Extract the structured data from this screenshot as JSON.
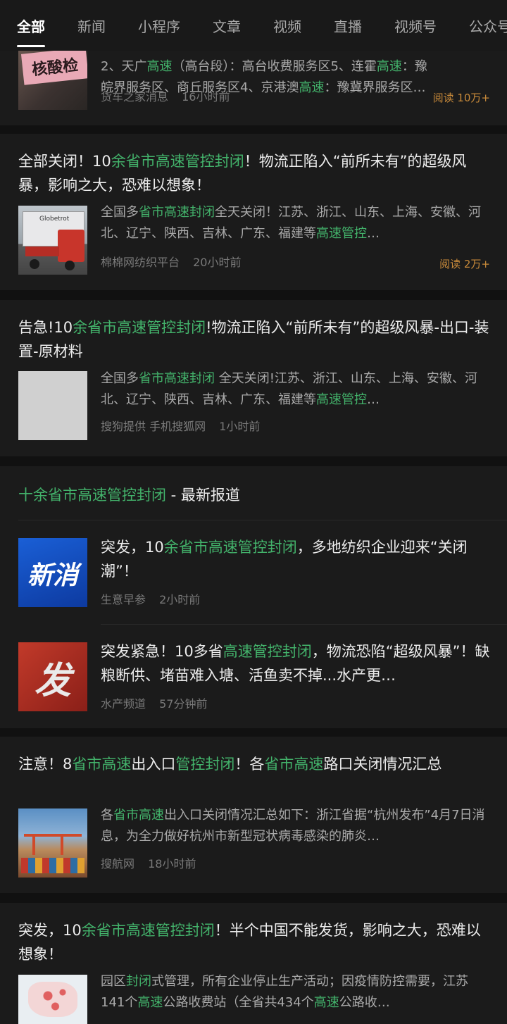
{
  "tabs": [
    "全部",
    "新闻",
    "小程序",
    "文章",
    "视频",
    "直播",
    "视频号",
    "公众号"
  ],
  "card1": {
    "snippet_line1_a": "2、天广",
    "snippet_line1_hl": "高速",
    "snippet_line1_b": "（高台段）：高台收费服务区5、连霍",
    "snippet_line1_hl2": "高速",
    "snippet_line1_c": "：豫",
    "snippet_line2_a": "皖界服务区、商丘服务区4、京港澳",
    "snippet_line2_hl": "高速",
    "snippet_line2_b": "：豫冀界服务区…",
    "source": "货车之家消息",
    "time": "16小时前",
    "reads": "阅读 10万+",
    "thumb_text": "核酸检"
  },
  "card2": {
    "title_a": "全部关闭！10",
    "title_hl": "余省市高速管控封闭",
    "title_b": "！物流正陷入“前所未有”的超级风暴，影响之大，恐难以想象！",
    "snippet_a": "全国多",
    "snippet_hl": "省市高速封闭",
    "snippet_b": "全天关闭！江苏、浙江、山东、上海、安徽、河北、辽宁、陕西、吉林、广东、福建等",
    "snippet_hl2": "高速管控",
    "snippet_c": "…",
    "source": "棉棉网纺织平台",
    "time": "20小时前",
    "reads": "阅读 2万+",
    "thumb_text": "Globetrot"
  },
  "card3": {
    "title_a": "告急!10",
    "title_hl": "余省市高速管控封闭",
    "title_b": "!物流正陷入“前所未有”的超级风暴-出口-装置-原材料",
    "snippet_a": "全国多",
    "snippet_hl": "省市高速封闭",
    "snippet_b": " 全天关闭!江苏、浙江、山东、上海、安徽、河北、辽宁、陕西、吉林、广东、福建等",
    "snippet_hl2": "高速管控",
    "snippet_c": "…",
    "source": "搜狗提供 手机搜狐网",
    "time": "1小时前"
  },
  "news_section": {
    "head_hl": "十余省市高速管控封闭",
    "head_b": " - 最新报道",
    "item1": {
      "title_a": "突发，10",
      "title_hl": "余省市高速管控封闭",
      "title_b": "，多地纺织企业迎来“关闭潮”！",
      "source": "生意早参",
      "time": "2小时前",
      "thumb_text": "新消"
    },
    "item2": {
      "title_a": "突发紧急！10多省",
      "title_hl": "高速管控封闭",
      "title_b": "，物流恐陷“超级风暴”！缺粮断供、堵苗难入塘、活鱼卖不掉...水产更…",
      "source": "水产频道",
      "time": "57分钟前",
      "thumb_text": "发"
    }
  },
  "card5": {
    "title_a": "注意！8",
    "title_hl": "省市高速",
    "title_b": "出入口",
    "title_hl2": "管控封闭",
    "title_c": "！各",
    "title_hl3": "省市高速",
    "title_d": "路口关闭情况汇总",
    "snippet_a": "各",
    "snippet_hl": "省市高速",
    "snippet_b": "出入口关闭情况汇总如下：浙江省据“杭州发布”4月7日消息，为全力做好杭州市新型冠状病毒感染的肺炎…",
    "source": "搜航网",
    "time": "18小时前"
  },
  "card6": {
    "title_a": "突发，10",
    "title_hl": "余省市高速管控封闭",
    "title_b": "！半个中国不能发货，影响之大，恐难以想象！",
    "snippet_a": "园区",
    "snippet_hl": "封闭",
    "snippet_b": "式管理，所有企业停止生产活动；因疫情防控需要，江苏141个",
    "snippet_hl2": "高速",
    "snippet_c": "公路收费站（全省共434个",
    "snippet_hl3": "高速",
    "snippet_d": "公路收…"
  },
  "colors": {
    "highlight": "#43b36b",
    "reads": "#c88a3a",
    "background": "#111111",
    "card": "#1b1b1b"
  }
}
